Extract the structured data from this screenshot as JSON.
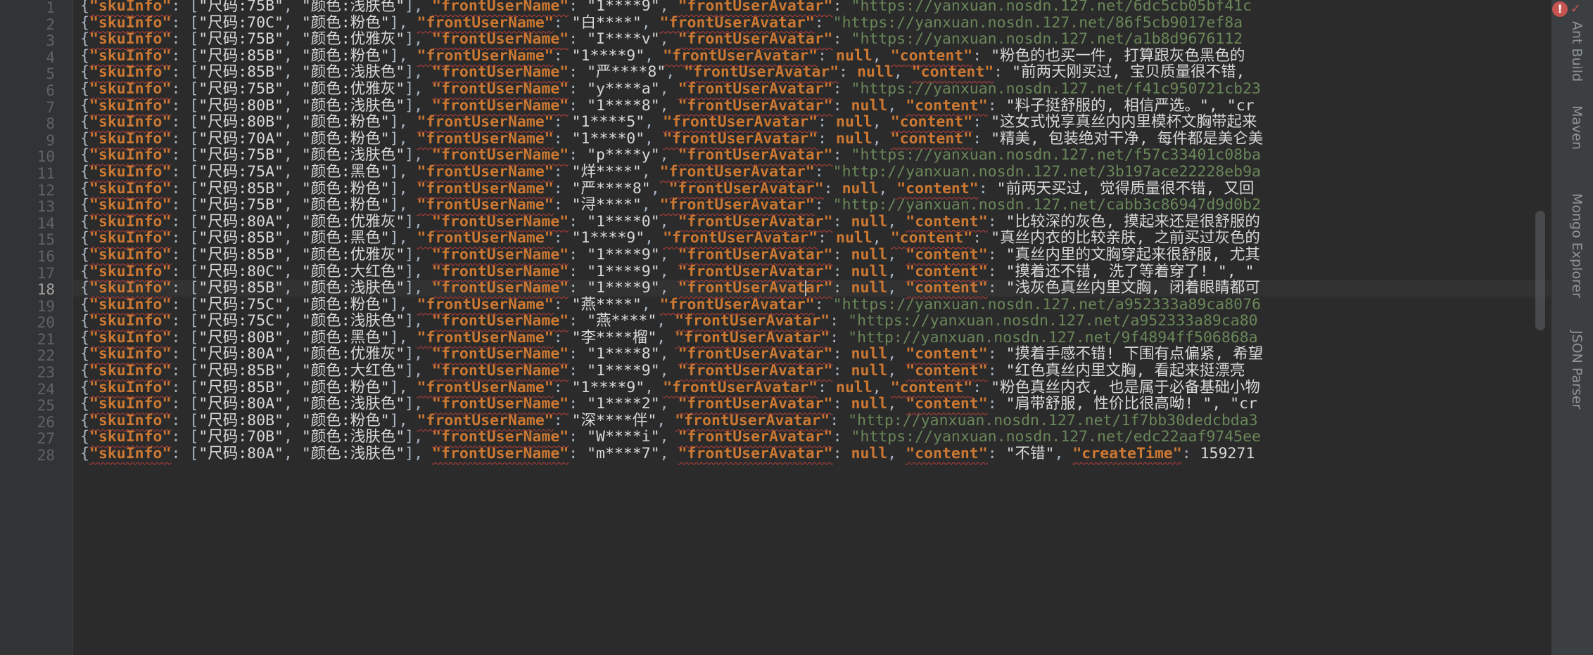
{
  "editor": {
    "current_line": 18,
    "key_sku": "\"skuInfo\"",
    "key_name": "\"frontUserName\"",
    "key_avatar": "\"frontUserAvatar\"",
    "key_content": "\"content\"",
    "key_createtime": "\"createTime\"",
    "lines": [
      {
        "n": "1",
        "size": "\"尺码:75B\"",
        "color": "\"颜色:浅肤色\"",
        "name": "\"1****9\"",
        "kind": "url",
        "tail": "\"https://yanxuan.nosdn.127.net/6dc5cb05bf41c"
      },
      {
        "n": "2",
        "size": "\"尺码:70C\"",
        "color": "\"颜色:粉色\"",
        "name": "\"白****\"",
        "kind": "url",
        "tail": "\"https://yanxuan.nosdn.127.net/86f5cb9017ef8a"
      },
      {
        "n": "3",
        "size": "\"尺码:75B\"",
        "color": "\"颜色:优雅灰\"",
        "name": "\"I****v\"",
        "kind": "url",
        "tail": "\"https://yanxuan.nosdn.127.net/a1b8d9676112"
      },
      {
        "n": "4",
        "size": "\"尺码:85B\"",
        "color": "\"颜色:粉色\"",
        "name": "\"1****9\"",
        "kind": "content",
        "tail": "\"粉色的也买一件, 打算跟灰色黑色的"
      },
      {
        "n": "5",
        "size": "\"尺码:85B\"",
        "color": "\"颜色:浅肤色\"",
        "name": "\"严****8\"",
        "kind": "content",
        "tail": "\"前两天刚买过, 宝贝质量很不错,"
      },
      {
        "n": "6",
        "size": "\"尺码:75B\"",
        "color": "\"颜色:优雅灰\"",
        "name": "\"y****a\"",
        "kind": "url",
        "tail": "\"https://yanxuan.nosdn.127.net/f41c950721cb23"
      },
      {
        "n": "7",
        "size": "\"尺码:80B\"",
        "color": "\"颜色:浅肤色\"",
        "name": "\"1****8\"",
        "kind": "content",
        "tail": "\"料子挺舒服的, 相信严选。\", \"cr"
      },
      {
        "n": "8",
        "size": "\"尺码:80B\"",
        "color": "\"颜色:粉色\"",
        "name": "\"1****5\"",
        "kind": "content",
        "tail": "\"这女式悦享真丝内内里模杯文胸带起来"
      },
      {
        "n": "9",
        "size": "\"尺码:70A\"",
        "color": "\"颜色:粉色\"",
        "name": "\"1****0\"",
        "kind": "content",
        "tail": "\"精美, 包装绝对干净, 每件都是美仑美"
      },
      {
        "n": "10",
        "size": "\"尺码:75B\"",
        "color": "\"颜色:浅肤色\"",
        "name": "\"p****y\"",
        "kind": "url",
        "tail": "\"https://yanxuan.nosdn.127.net/f57c33401c08ba"
      },
      {
        "n": "11",
        "size": "\"尺码:75A\"",
        "color": "\"颜色:黑色\"",
        "name": "\"烊****\"",
        "kind": "url",
        "tail": "\"http://yanxuan.nosdn.127.net/3b197ace22228eb9a"
      },
      {
        "n": "12",
        "size": "\"尺码:85B\"",
        "color": "\"颜色:粉色\"",
        "name": "\"严****8\"",
        "kind": "content",
        "tail": "\"前两天买过, 觉得质量很不错, 又回"
      },
      {
        "n": "13",
        "size": "\"尺码:75B\"",
        "color": "\"颜色:粉色\"",
        "name": "\"浔****\"",
        "kind": "url",
        "tail": "\"http://yanxuan.nosdn.127.net/cabb3c86947d9d0b2"
      },
      {
        "n": "14",
        "size": "\"尺码:80A\"",
        "color": "\"颜色:优雅灰\"",
        "name": "\"1****0\"",
        "kind": "content",
        "tail": "\"比较深的灰色, 摸起来还是很舒服的"
      },
      {
        "n": "15",
        "size": "\"尺码:85B\"",
        "color": "\"颜色:黑色\"",
        "name": "\"1****9\"",
        "kind": "content",
        "tail": "\"真丝内衣的比较亲肤, 之前买过灰色的"
      },
      {
        "n": "16",
        "size": "\"尺码:85B\"",
        "color": "\"颜色:优雅灰\"",
        "name": "\"1****9\"",
        "kind": "content",
        "tail": "\"真丝内里的文胸穿起来很舒服, 尤其"
      },
      {
        "n": "17",
        "size": "\"尺码:80C\"",
        "color": "\"颜色:大红色\"",
        "name": "\"1****9\"",
        "kind": "content",
        "tail": "\"摸着还不错, 洗了等着穿了! \", \""
      },
      {
        "n": "18",
        "size": "\"尺码:85B\"",
        "color": "\"颜色:浅肤色\"",
        "name": "\"1****9\"",
        "kind": "content",
        "tail": "\"浅灰色真丝内里文胸, 闭着眼睛都可"
      },
      {
        "n": "19",
        "size": "\"尺码:75C\"",
        "color": "\"颜色:粉色\"",
        "name": "\"燕****\"",
        "kind": "url",
        "tail": "\"https://yanxuan.nosdn.127.net/a952333a89ca8076"
      },
      {
        "n": "20",
        "size": "\"尺码:75C\"",
        "color": "\"颜色:浅肤色\"",
        "name": "\"燕****\"",
        "kind": "url",
        "tail": "\"https://yanxuan.nosdn.127.net/a952333a89ca80"
      },
      {
        "n": "21",
        "size": "\"尺码:80B\"",
        "color": "\"颜色:黑色\"",
        "name": "\"李****榴\"",
        "kind": "url",
        "tail": "\"http://yanxuan.nosdn.127.net/9f4894ff506868a"
      },
      {
        "n": "22",
        "size": "\"尺码:80A\"",
        "color": "\"颜色:优雅灰\"",
        "name": "\"1****8\"",
        "kind": "content",
        "tail": "\"摸着手感不错! 下围有点偏紧, 希望"
      },
      {
        "n": "23",
        "size": "\"尺码:85B\"",
        "color": "\"颜色:大红色\"",
        "name": "\"1****9\"",
        "kind": "content",
        "tail": "\"红色真丝内里文胸, 看起来挺漂亮"
      },
      {
        "n": "24",
        "size": "\"尺码:85B\"",
        "color": "\"颜色:粉色\"",
        "name": "\"1****9\"",
        "kind": "content",
        "tail": "\"粉色真丝内衣, 也是属于必备基础小物"
      },
      {
        "n": "25",
        "size": "\"尺码:80A\"",
        "color": "\"颜色:浅肤色\"",
        "name": "\"1****2\"",
        "kind": "content",
        "tail": "\"肩带舒服, 性价比很高呦! \", \"cr"
      },
      {
        "n": "26",
        "size": "\"尺码:80B\"",
        "color": "\"颜色:粉色\"",
        "name": "\"深****伴\"",
        "kind": "url",
        "tail": "\"http://yanxuan.nosdn.127.net/1f7bb30dedcbda3"
      },
      {
        "n": "27",
        "size": "\"尺码:70B\"",
        "color": "\"颜色:浅肤色\"",
        "name": "\"W****i\"",
        "kind": "url",
        "tail": "\"https://yanxuan.nosdn.127.net/edc22aaf9745ee"
      },
      {
        "n": "28",
        "size": "\"尺码:80A\"",
        "color": "\"颜色:浅肤色\"",
        "name": "\"m****7\"",
        "kind": "createtime",
        "tail": "\"不错\"",
        "time": "159271"
      }
    ]
  },
  "side_tabs": {
    "ant_build": "Ant Build",
    "maven": "Maven",
    "mongo_explorer": "Mongo Explorer",
    "json_parser": "JSON Parser"
  },
  "icons": {
    "error": "error-icon",
    "check": "check-icon"
  },
  "colors": {
    "background": "#2b2b2b",
    "gutter": "#313335",
    "key": "#cc7832",
    "string": "#d8d8d8",
    "url": "#6a8759",
    "line_number": "#606366",
    "current_line": "#323232"
  }
}
